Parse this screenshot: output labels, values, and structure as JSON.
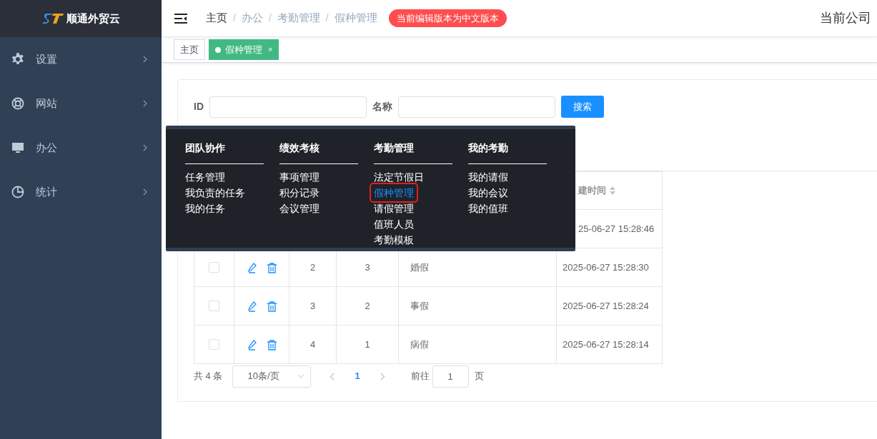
{
  "sidebar": {
    "logo": "顺通外贸云",
    "items": [
      {
        "label": "设置"
      },
      {
        "label": "网站"
      },
      {
        "label": "办公"
      },
      {
        "label": "统计"
      }
    ]
  },
  "header": {
    "breadcrumb": [
      "主页",
      "办公",
      "考勤管理",
      "假种管理"
    ],
    "separator": "/",
    "badge": "当前编辑版本为中文版本",
    "company": "当前公司"
  },
  "tabs": [
    {
      "label": "主页",
      "selected": false
    },
    {
      "label": "假种管理",
      "selected": true,
      "close": "×"
    }
  ],
  "search": {
    "fields": [
      {
        "label": "ID"
      },
      {
        "label": "名称"
      }
    ],
    "button": "搜索"
  },
  "table": {
    "last_column_header": "建时间",
    "rows": [
      {
        "cells": [],
        "time": "25-06-27 15:28:46"
      },
      {
        "cells": [
          "2",
          "3",
          "婚假"
        ],
        "time": "2025-06-27 15:28:30",
        "checked": false
      },
      {
        "cells": [
          "3",
          "2",
          "事假"
        ],
        "time": "2025-06-27 15:28:24",
        "checked": false
      },
      {
        "cells": [
          "4",
          "1",
          "病假"
        ],
        "time": "2025-06-27 15:28:14",
        "checked": false
      }
    ]
  },
  "pagination": {
    "total": "共 4 条",
    "page_size": "10条/页",
    "pages": [
      {
        "label": "1",
        "selected": true
      }
    ],
    "goto": "前往",
    "page_value": "1",
    "page_unit": "页"
  },
  "mega_menu": {
    "columns": [
      {
        "title": "团队协作",
        "items": [
          {
            "label": "任务管理",
            "selected": false
          },
          {
            "label": "我负责的任务",
            "selected": false
          },
          {
            "label": "我的任务",
            "selected": false
          }
        ]
      },
      {
        "title": "绩效考核",
        "items": [
          {
            "label": "事项管理",
            "selected": false
          },
          {
            "label": "积分记录",
            "selected": false
          },
          {
            "label": "会议管理",
            "selected": false
          }
        ]
      },
      {
        "title": "考勤管理",
        "items": [
          {
            "label": "法定节假日",
            "selected": false
          },
          {
            "label": "假种管理",
            "selected": true
          },
          {
            "label": "请假管理",
            "selected": false
          },
          {
            "label": "值班人员",
            "selected": false
          },
          {
            "label": "考勤模板",
            "selected": false
          }
        ]
      },
      {
        "title": "我的考勤",
        "items": [
          {
            "label": "我的请假",
            "selected": false
          },
          {
            "label": "我的会议",
            "selected": false
          },
          {
            "label": "我的值班",
            "selected": false
          }
        ]
      }
    ]
  }
}
